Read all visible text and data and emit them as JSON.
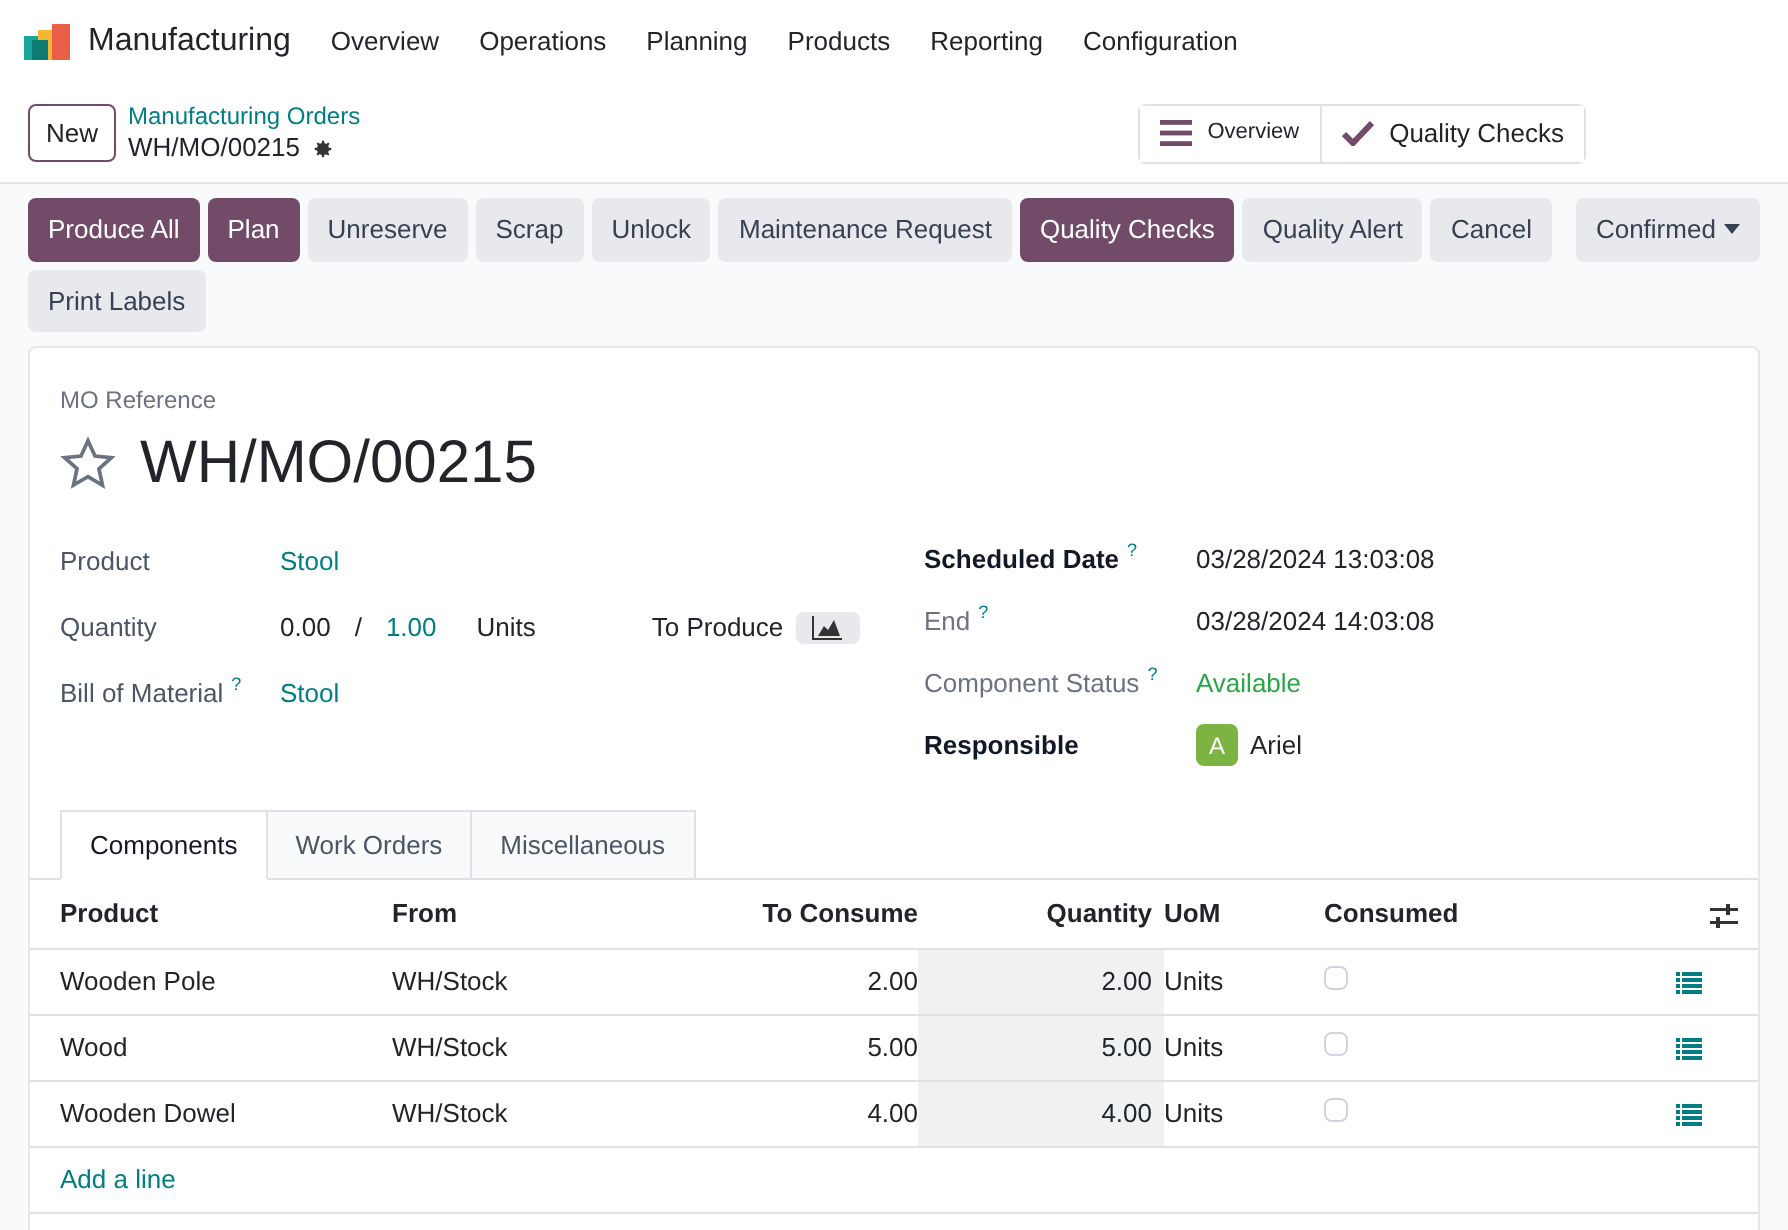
{
  "app": {
    "name": "Manufacturing"
  },
  "menu": [
    "Overview",
    "Operations",
    "Planning",
    "Products",
    "Reporting",
    "Configuration"
  ],
  "breadcrumb": {
    "new_button": "New",
    "parent": "Manufacturing Orders",
    "current": "WH/MO/00215"
  },
  "view_buttons": [
    {
      "label": "Overview",
      "kind": "menu"
    },
    {
      "label": "Quality Checks",
      "kind": "check"
    }
  ],
  "actions": [
    {
      "label": "Produce All",
      "kind": "primary"
    },
    {
      "label": "Plan",
      "kind": "primary"
    },
    {
      "label": "Unreserve",
      "kind": "secondary"
    },
    {
      "label": "Scrap",
      "kind": "secondary"
    },
    {
      "label": "Unlock",
      "kind": "secondary"
    },
    {
      "label": "Maintenance Request",
      "kind": "secondary"
    },
    {
      "label": "Quality Checks",
      "kind": "primary"
    },
    {
      "label": "Quality Alert",
      "kind": "secondary"
    },
    {
      "label": "Cancel",
      "kind": "secondary"
    }
  ],
  "status": {
    "label": "Confirmed"
  },
  "second_actions": [
    {
      "label": "Print Labels",
      "kind": "secondary"
    }
  ],
  "form": {
    "reference_label": "MO Reference",
    "reference": "WH/MO/00215",
    "starred": false,
    "left_fields": [
      {
        "kind": "link",
        "label": "Product",
        "value": "Stool"
      },
      {
        "kind": "quantity",
        "label": "Quantity",
        "produced": "0.00",
        "separator": "/",
        "planned": "1.00",
        "uom": "Units",
        "extra_label": "To Produce"
      },
      {
        "kind": "link",
        "label": "Bill of Material",
        "help": "?",
        "value": "Stool"
      }
    ],
    "right_fields": [
      {
        "kind": "text",
        "label": "Scheduled Date",
        "emphasis": true,
        "help": "?",
        "value": "03/28/2024 13:03:08"
      },
      {
        "kind": "text",
        "label": "End",
        "emphasis": false,
        "help": "?",
        "value": "03/28/2024 14:03:08"
      },
      {
        "kind": "status",
        "label": "Component Status",
        "emphasis": false,
        "help": "?",
        "value": "Available"
      },
      {
        "kind": "avatar",
        "label": "Responsible",
        "emphasis": true,
        "initial": "A",
        "value": "Ariel"
      }
    ]
  },
  "tabs": [
    {
      "label": "Components",
      "selected": true
    },
    {
      "label": "Work Orders",
      "selected": false
    },
    {
      "label": "Miscellaneous",
      "selected": false
    }
  ],
  "table": {
    "columns": [
      "Product",
      "From",
      "To Consume",
      "Quantity",
      "UoM",
      "Consumed"
    ],
    "rows": [
      {
        "product": "Wooden Pole",
        "from": "WH/Stock",
        "to_consume": "2.00",
        "quantity": "2.00",
        "uom": "Units",
        "consumed": false
      },
      {
        "product": "Wood",
        "from": "WH/Stock",
        "to_consume": "5.00",
        "quantity": "5.00",
        "uom": "Units",
        "consumed": false
      },
      {
        "product": "Wooden Dowel",
        "from": "WH/Stock",
        "to_consume": "4.00",
        "quantity": "4.00",
        "uom": "Units",
        "consumed": false
      }
    ],
    "add_line": "Add a line"
  }
}
